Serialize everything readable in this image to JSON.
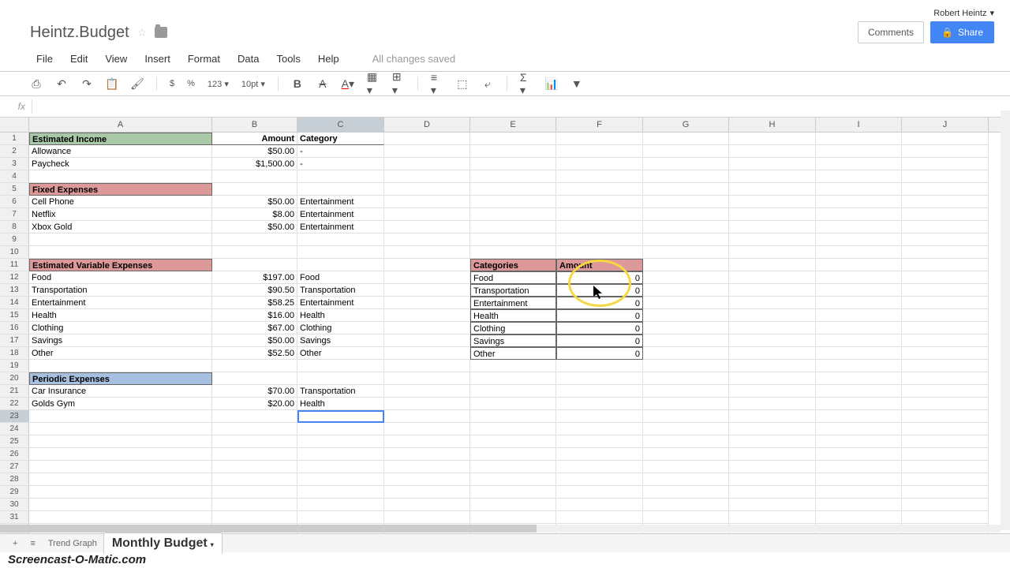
{
  "user": "Robert Heintz",
  "title": "Heintz.Budget",
  "menu": {
    "file": "File",
    "edit": "Edit",
    "view": "View",
    "insert": "Insert",
    "format": "Format",
    "data": "Data",
    "tools": "Tools",
    "help": "Help"
  },
  "save_status": "All changes saved",
  "comments_btn": "Comments",
  "share_btn": "Share",
  "toolbar": {
    "currency": "$",
    "percent": "%",
    "numfmt": "123",
    "fontsize": "10pt"
  },
  "fx": "fx",
  "columns": [
    "A",
    "B",
    "C",
    "D",
    "E",
    "F",
    "G",
    "H",
    "I",
    "J"
  ],
  "rows": {
    "1": {
      "A": "Estimated Income",
      "B": "Amount",
      "C": "Category",
      "A_class": "header-green",
      "B_class": "header-plain",
      "C_class": "header-plain"
    },
    "2": {
      "A": "Allowance",
      "B": "$50.00",
      "C": "-"
    },
    "3": {
      "A": "Paycheck",
      "B": "$1,500.00",
      "C": "-"
    },
    "5": {
      "A": "Fixed Expenses",
      "A_class": "header-red"
    },
    "6": {
      "A": "Cell Phone",
      "B": "$50.00",
      "C": "Entertainment"
    },
    "7": {
      "A": "Netflix",
      "B": "$8.00",
      "C": "Entertainment"
    },
    "8": {
      "A": "Xbox Gold",
      "B": "$50.00",
      "C": "Entertainment"
    },
    "11": {
      "A": "Estimated Variable Expenses",
      "A_class": "header-red",
      "E": "Categories",
      "E_class": "header-red boxed",
      "F": "Amount",
      "F_class": "header-red boxed"
    },
    "12": {
      "A": "Food",
      "B": "$197.00",
      "C": "Food",
      "E": "Food",
      "E_class": "boxed",
      "F": "0",
      "F_class": "boxed right"
    },
    "13": {
      "A": "Transportation",
      "B": "$90.50",
      "C": "Transportation",
      "E": "Transportation",
      "E_class": "boxed",
      "F": "0",
      "F_class": "boxed right"
    },
    "14": {
      "A": "Entertainment",
      "B": "$58.25",
      "C": "Entertainment",
      "E": "Entertainment",
      "E_class": "boxed",
      "F": "0",
      "F_class": "boxed right"
    },
    "15": {
      "A": "Health",
      "B": "$16.00",
      "C": "Health",
      "E": "Health",
      "E_class": "boxed",
      "F": "0",
      "F_class": "boxed right"
    },
    "16": {
      "A": "Clothing",
      "B": "$67.00",
      "C": "Clothing",
      "E": "Clothing",
      "E_class": "boxed",
      "F": "0",
      "F_class": "boxed right"
    },
    "17": {
      "A": "Savings",
      "B": "$50.00",
      "C": "Savings",
      "E": "Savings",
      "E_class": "boxed",
      "F": "0",
      "F_class": "boxed right"
    },
    "18": {
      "A": "Other",
      "B": "$52.50",
      "C": "Other",
      "E": "Other",
      "E_class": "boxed",
      "F": "0",
      "F_class": "boxed right"
    },
    "20": {
      "A": "Periodic Expenses",
      "A_class": "header-blue"
    },
    "21": {
      "A": "Car Insurance",
      "B": "$70.00",
      "C": "Transportation"
    },
    "22": {
      "A": "Golds Gym",
      "B": "$20.00",
      "C": "Health"
    }
  },
  "selected_cell": {
    "row": 23,
    "col": "C"
  },
  "tabs": {
    "trend": "Trend Graph",
    "monthly": "Monthly Budget"
  },
  "watermark": "Screencast-O-Matic.com"
}
